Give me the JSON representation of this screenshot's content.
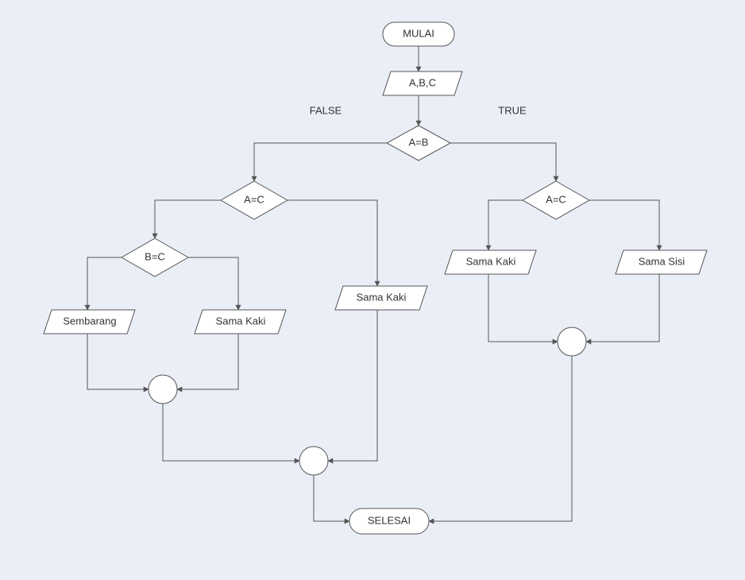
{
  "chart_data": {
    "type": "flowchart",
    "title": "",
    "nodes": [
      {
        "id": "start",
        "type": "terminator",
        "label": "MULAI"
      },
      {
        "id": "input",
        "type": "io",
        "label": "A,B,C"
      },
      {
        "id": "d1",
        "type": "decision",
        "label": "A=B"
      },
      {
        "id": "d2l",
        "type": "decision",
        "label": "A=C"
      },
      {
        "id": "d2r",
        "type": "decision",
        "label": "A=C"
      },
      {
        "id": "d3",
        "type": "decision",
        "label": "B=C"
      },
      {
        "id": "o_sembarang",
        "type": "io",
        "label": "Sembarang"
      },
      {
        "id": "o_samakaki_l",
        "type": "io",
        "label": "Sama Kaki"
      },
      {
        "id": "o_samakaki_m",
        "type": "io",
        "label": "Sama Kaki"
      },
      {
        "id": "o_samakaki_r",
        "type": "io",
        "label": "Sama Kaki"
      },
      {
        "id": "o_samasisi",
        "type": "io",
        "label": "Sama Sisi"
      },
      {
        "id": "c1",
        "type": "connector",
        "label": ""
      },
      {
        "id": "c2",
        "type": "connector",
        "label": ""
      },
      {
        "id": "c3",
        "type": "connector",
        "label": ""
      },
      {
        "id": "end",
        "type": "terminator",
        "label": "SELESAI"
      }
    ],
    "edges": [
      {
        "from": "start",
        "to": "input"
      },
      {
        "from": "input",
        "to": "d1"
      },
      {
        "from": "d1",
        "to": "d2l",
        "label": "FALSE"
      },
      {
        "from": "d1",
        "to": "d2r",
        "label": "TRUE"
      },
      {
        "from": "d2l",
        "to": "d3"
      },
      {
        "from": "d2l",
        "to": "o_samakaki_m"
      },
      {
        "from": "d3",
        "to": "o_sembarang"
      },
      {
        "from": "d3",
        "to": "o_samakaki_l"
      },
      {
        "from": "d2r",
        "to": "o_samakaki_r"
      },
      {
        "from": "d2r",
        "to": "o_samasisi"
      },
      {
        "from": "o_sembarang",
        "to": "c1"
      },
      {
        "from": "o_samakaki_l",
        "to": "c1"
      },
      {
        "from": "c1",
        "to": "c2"
      },
      {
        "from": "o_samakaki_m",
        "to": "c2"
      },
      {
        "from": "o_samakaki_r",
        "to": "c3"
      },
      {
        "from": "o_samasisi",
        "to": "c3"
      },
      {
        "from": "c2",
        "to": "end"
      },
      {
        "from": "c3",
        "to": "end"
      }
    ],
    "branch_labels": {
      "false": "FALSE",
      "true": "TRUE"
    }
  },
  "labels": {
    "start": "MULAI",
    "input": "A,B,C",
    "d1": "A=B",
    "d2l": "A=C",
    "d2r": "A=C",
    "d3": "B=C",
    "sembarang": "Sembarang",
    "samakaki1": "Sama Kaki",
    "samakaki2": "Sama Kaki",
    "samakaki3": "Sama Kaki",
    "samasisi": "Sama Sisi",
    "end": "SELESAI",
    "false": "FALSE",
    "true": "TRUE"
  }
}
